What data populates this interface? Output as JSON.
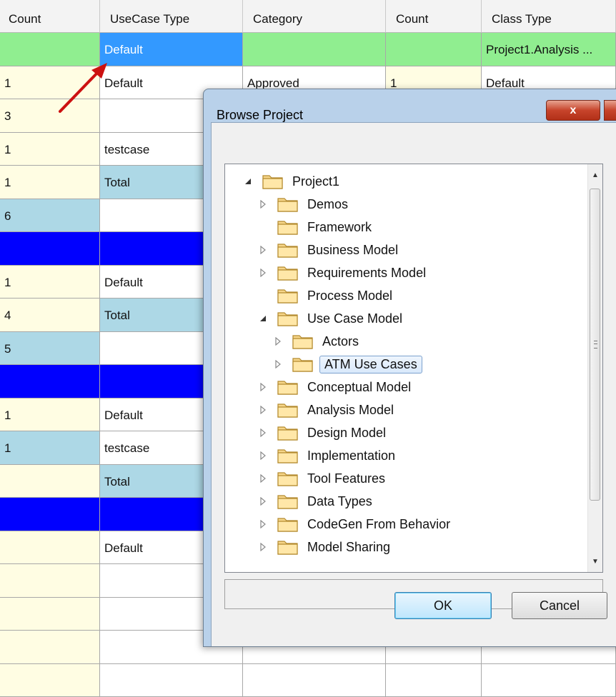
{
  "grid": {
    "headers": [
      "Count",
      "UseCase Type",
      "Category",
      "Count",
      "Class Type"
    ],
    "rows": [
      [
        "",
        "Default",
        "",
        "",
        "Project1.Analysis ..."
      ],
      [
        "1",
        "Default",
        "Approved",
        "1",
        "Default"
      ],
      [
        "3",
        "",
        "",
        "",
        ""
      ],
      [
        "1",
        "testcase",
        "",
        "",
        ""
      ],
      [
        "1",
        "Total",
        "",
        "",
        ""
      ],
      [
        "6",
        "",
        "",
        "",
        ""
      ],
      [
        "",
        "",
        "",
        "",
        ""
      ],
      [
        "1",
        "Default",
        "",
        "",
        ""
      ],
      [
        "4",
        "Total",
        "",
        "",
        ""
      ],
      [
        "5",
        "",
        "",
        "",
        ""
      ],
      [
        "",
        "",
        "",
        "",
        ""
      ],
      [
        "1",
        "Default",
        "",
        "",
        ""
      ],
      [
        "1",
        "testcase",
        "",
        "",
        ""
      ],
      [
        "",
        "Total",
        "",
        "",
        ""
      ],
      [
        "",
        "",
        "",
        "",
        ""
      ],
      [
        "",
        "Default",
        "",
        "",
        ""
      ],
      [
        "",
        "",
        "",
        "",
        ""
      ],
      [
        "",
        "",
        "",
        "",
        ""
      ],
      [
        "",
        "",
        "",
        "",
        ""
      ],
      [
        "",
        "",
        "",
        "",
        ""
      ]
    ]
  },
  "colors": {
    "cream": "#fffde3",
    "green": "#90ee90",
    "selected": "#3399ff",
    "lightblue": "#add8e6",
    "blue": "#0000ff"
  },
  "dialog": {
    "title": "Browse Project",
    "close_label": "x",
    "tree": [
      {
        "label": "Project1",
        "expander": "expanded",
        "icon": "folder-icon"
      },
      {
        "label": "Demos",
        "expander": "collapsed",
        "icon": "folder-icon"
      },
      {
        "label": "Framework",
        "expander": "none",
        "icon": "folder-icon"
      },
      {
        "label": "Business Model",
        "expander": "collapsed",
        "icon": "folder-icon"
      },
      {
        "label": "Requirements Model",
        "expander": "collapsed",
        "icon": "folder-icon"
      },
      {
        "label": "Process Model",
        "expander": "none",
        "icon": "folder-icon"
      },
      {
        "label": "Use Case Model",
        "expander": "expanded",
        "icon": "folder-icon"
      },
      {
        "label": "Actors",
        "expander": "collapsed",
        "icon": "folder-icon"
      },
      {
        "label": "ATM Use Cases",
        "expander": "collapsed",
        "icon": "folder-icon",
        "selected": true
      },
      {
        "label": "Conceptual Model",
        "expander": "collapsed",
        "icon": "folder-icon"
      },
      {
        "label": "Analysis Model",
        "expander": "collapsed",
        "icon": "folder-icon"
      },
      {
        "label": "Design Model",
        "expander": "collapsed",
        "icon": "folder-icon"
      },
      {
        "label": "Implementation",
        "expander": "collapsed",
        "icon": "folder-icon"
      },
      {
        "label": "Tool Features",
        "expander": "collapsed",
        "icon": "folder-icon"
      },
      {
        "label": "Data Types",
        "expander": "collapsed",
        "icon": "folder-icon"
      },
      {
        "label": "CodeGen From Behavior",
        "expander": "collapsed",
        "icon": "folder-icon"
      },
      {
        "label": "Model Sharing",
        "expander": "collapsed",
        "icon": "folder-icon"
      }
    ],
    "ok_label": "OK",
    "cancel_label": "Cancel"
  }
}
